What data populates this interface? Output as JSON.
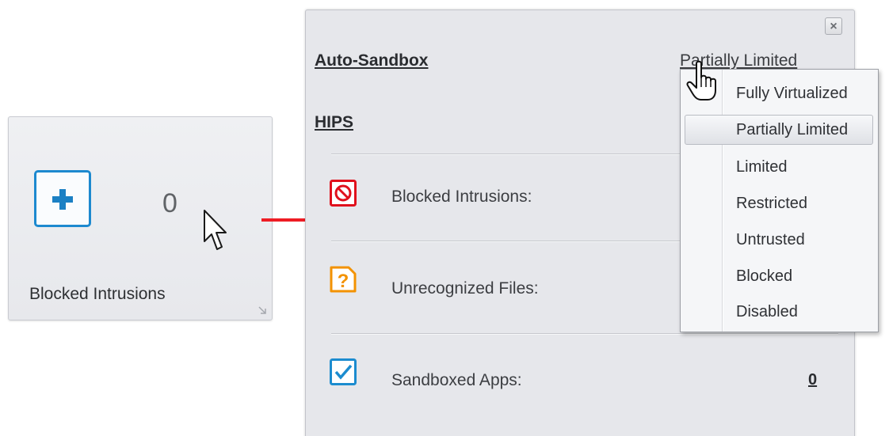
{
  "tile": {
    "count": "0",
    "label": "Blocked Intrusions",
    "icon": "plus-icon"
  },
  "panel": {
    "close_label": "×",
    "auto_sandbox": {
      "label": "Auto-Sandbox",
      "mode": "Partially Limited"
    },
    "hips": {
      "label": "HIPS"
    },
    "rows": [
      {
        "label": "Blocked Intrusions:",
        "icon": "blocked-icon",
        "color": "#e0101c",
        "value": ""
      },
      {
        "label": "Unrecognized Files:",
        "icon": "question-icon",
        "color": "#f39200",
        "value": ""
      },
      {
        "label": "Sandboxed Apps:",
        "icon": "checkbox-icon",
        "color": "#1c8ccf",
        "value": "0"
      }
    ]
  },
  "dropdown": {
    "selected": "Partially Limited",
    "options": [
      "Fully Virtualized",
      "Partially Limited",
      "Limited",
      "Restricted",
      "Untrusted",
      "Blocked",
      "Disabled"
    ]
  },
  "colors": {
    "arrow": "#ee1c24",
    "accent": "#1d89cf"
  }
}
